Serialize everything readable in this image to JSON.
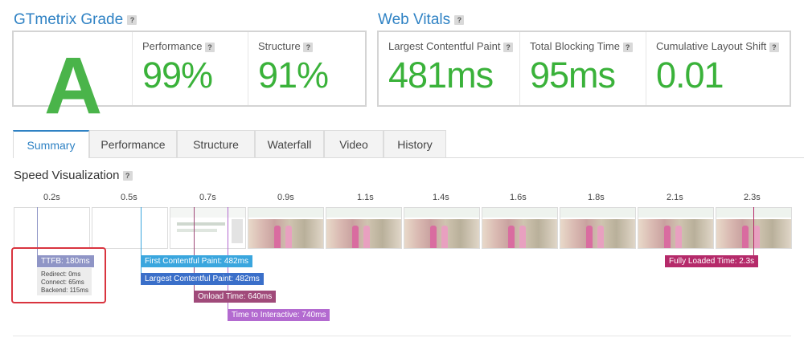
{
  "gtmetrix": {
    "title": "GTmetrix Grade",
    "help": "?",
    "grade": "A",
    "performance_label": "Performance",
    "performance_value": "99%",
    "structure_label": "Structure",
    "structure_value": "91%"
  },
  "vitals": {
    "title": "Web Vitals",
    "help": "?",
    "lcp_label": "Largest Contentful Paint",
    "lcp_value": "481ms",
    "tbt_label": "Total Blocking Time",
    "tbt_value": "95ms",
    "cls_label": "Cumulative Layout Shift",
    "cls_value": "0.01"
  },
  "tabs": [
    "Summary",
    "Performance",
    "Structure",
    "Waterfall",
    "Video",
    "History"
  ],
  "active_tab": "Summary",
  "speed": {
    "title": "Speed Visualization",
    "help": "?",
    "ticks": [
      "0.2s",
      "0.5s",
      "0.7s",
      "0.9s",
      "1.1s",
      "1.4s",
      "1.6s",
      "1.8s",
      "2.1s",
      "2.3s"
    ],
    "ttfb_label": "TTFB: 180ms",
    "ttfb_redirect": "Redirect: 0ms",
    "ttfb_connect": "Connect: 65ms",
    "ttfb_backend": "Backend: 115ms",
    "fcp_label": "First Contentful Paint: 482ms",
    "lcp_label": "Largest Contentful Paint: 482ms",
    "onload_label": "Onload Time: 640ms",
    "tti_label": "Time to Interactive: 740ms",
    "fully_loaded_label": "Fully Loaded Time: 2.3s"
  },
  "colors": {
    "accent": "#2f82c4",
    "grade_green": "#4ab44a",
    "ttfb": "#8f95c6",
    "fcp": "#3aa6de",
    "lcp": "#3a6fc9",
    "onload": "#a04a7a",
    "tti": "#b36ad0",
    "fully_loaded": "#b52a6a",
    "highlight_box": "#d9343f"
  }
}
